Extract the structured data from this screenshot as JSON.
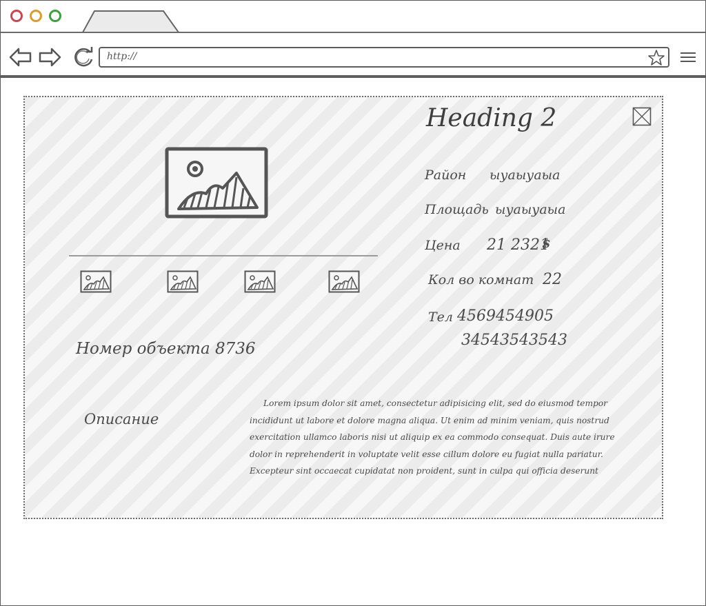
{
  "browser": {
    "url": "http://",
    "colors": {
      "close": "#c9474f",
      "minimize": "#e09a2c",
      "maximize": "#3aa23a"
    }
  },
  "listing": {
    "heading": "Heading 2",
    "object_number": "Номер объекта 8736",
    "props": {
      "district": {
        "label": "Район",
        "value": "ыуаыуаыа"
      },
      "area": {
        "label": "Площадь",
        "value": "ыуаыуаыа"
      },
      "price": {
        "label": "Цена",
        "value": "21 2321",
        "currency": "$"
      },
      "rooms": {
        "label": "Кол во комнат",
        "value": "22"
      },
      "phone": {
        "label": "Тел",
        "value1": "4569454905",
        "value2": "34543543543"
      }
    },
    "description": {
      "label": "Описание",
      "text": "Lorem ipsum dolor sit amet, consectetur adipisicing elit, sed do eiusmod tempor incididunt ut labore et dolore magna aliqua. Ut enim ad minim veniam, quis nostrud exercitation ullamco laboris nisi ut aliquip ex ea commodo consequat. Duis aute irure dolor in reprehenderit in voluptate velit esse cillum dolore eu fugiat nulla pariatur. Excepteur sint occaecat cupidatat non proident, sunt in culpa qui officia deserunt"
    },
    "icons": {
      "main_image": "image-placeholder-icon",
      "thumbnails": [
        "image-placeholder-icon",
        "image-placeholder-icon",
        "image-placeholder-icon",
        "image-placeholder-icon"
      ],
      "close": "close-x-box-icon"
    }
  }
}
